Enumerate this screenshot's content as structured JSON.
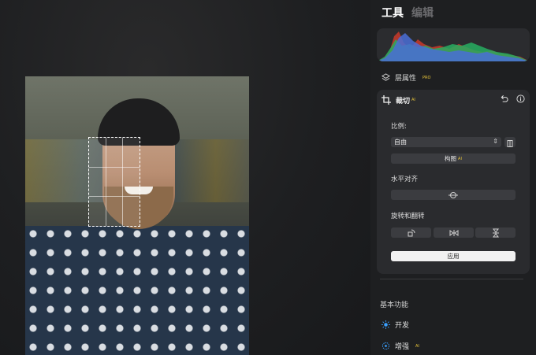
{
  "tabs": [
    {
      "label": "工具",
      "active": true
    },
    {
      "label": "编辑",
      "active": false
    }
  ],
  "layer": {
    "label": "层属性",
    "badge": "PRO",
    "icon": "layers-icon"
  },
  "crop_panel": {
    "title": "裁切",
    "title_badge": "AI",
    "ratio_label": "比例:",
    "ratio_value": "自由",
    "compose_label": "构图",
    "compose_badge": "AI",
    "level_label": "水平对齐",
    "rotate_label": "旋转和翻转",
    "apply_label": "应用"
  },
  "basic": {
    "title": "基本功能",
    "items": [
      {
        "label": "开发",
        "badge": "",
        "icon": "sun-icon"
      },
      {
        "label": "增强",
        "badge": "AI",
        "icon": "sparkle-icon"
      }
    ]
  },
  "colors": {
    "accent": "#3aa0ff",
    "ai_badge": "#e8c43a",
    "panel_bg": "#1e1f21",
    "card_bg": "#2a2b2e"
  }
}
